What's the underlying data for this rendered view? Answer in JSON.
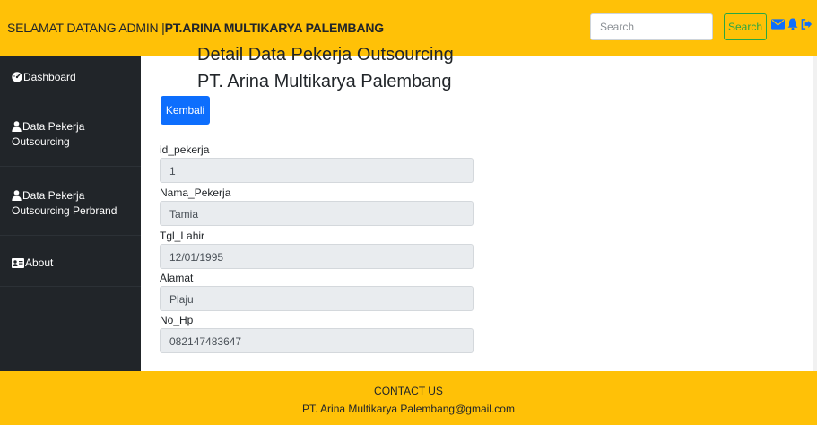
{
  "header": {
    "welcome_text": "SELAMAT DATANG ADMIN |",
    "company_name": "PT.ARINA MULTIKARYA PALEMBANG",
    "search_placeholder": "Search",
    "search_button_label": "Search",
    "icons": [
      "envelope-icon",
      "bell-icon",
      "logout-icon"
    ]
  },
  "sidebar": {
    "items": [
      {
        "label": "Dashboard",
        "icon": "dashboard-icon"
      },
      {
        "label_line1": "Data Pekerja",
        "label_line2": "Outsourcing",
        "icon": "user-icon"
      },
      {
        "label_line1": "Data Pekerja",
        "label_line2": "Outsourcing Perbrand",
        "icon": "user-icon"
      },
      {
        "label": "About",
        "icon": "id-card-icon"
      }
    ]
  },
  "main": {
    "title_line1": "Detail Data Pekerja Outsourcing",
    "title_line2": "PT. Arina Multikarya Palembang",
    "back_button_label": "Kembali",
    "fields": [
      {
        "label": "id_pekerja",
        "value": "1"
      },
      {
        "label": "Nama_Pekerja",
        "value": "Tamia"
      },
      {
        "label": "Tgl_Lahir",
        "value": "12/01/1995"
      },
      {
        "label": "Alamat",
        "value": "Plaju"
      },
      {
        "label": "No_Hp",
        "value": "082147483647"
      }
    ]
  },
  "footer": {
    "heading": "CONTACT US",
    "email": "PT. Arina Multikarya Palembang@gmail.com"
  },
  "colors": {
    "accent_yellow": "#ffc107",
    "sidebar_dark": "#212529",
    "primary_blue": "#0d6efd",
    "success_green": "#28a745",
    "icon_blue": "#0d6efd"
  }
}
